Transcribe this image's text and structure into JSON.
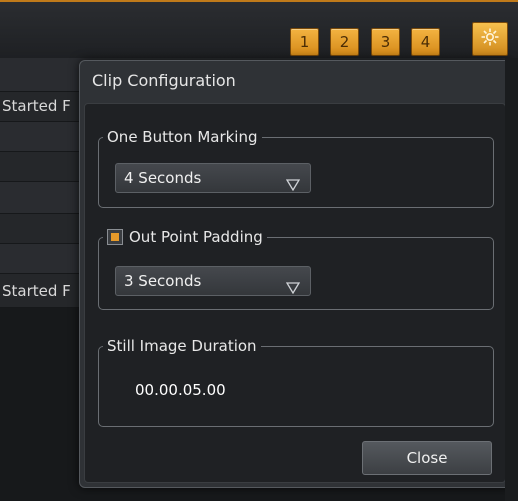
{
  "header": {
    "page_buttons": [
      "1",
      "2",
      "3",
      "4"
    ],
    "settings_icon": "gear-icon"
  },
  "background_list": {
    "row_labels": [
      "Started F",
      "Started F"
    ]
  },
  "dialog": {
    "title": "Clip Configuration",
    "one_button_marking": {
      "legend": "One Button Marking",
      "selected": "4 Seconds"
    },
    "out_point_padding": {
      "legend": "Out Point Padding",
      "checked": true,
      "selected": "3 Seconds"
    },
    "still_image_duration": {
      "legend": "Still Image Duration",
      "value": "00.00.05.00"
    },
    "close_label": "Close"
  },
  "colors": {
    "accent_orange": "#e69a2a",
    "panel": "#2f3236",
    "panel_inner": "#1f2124"
  }
}
